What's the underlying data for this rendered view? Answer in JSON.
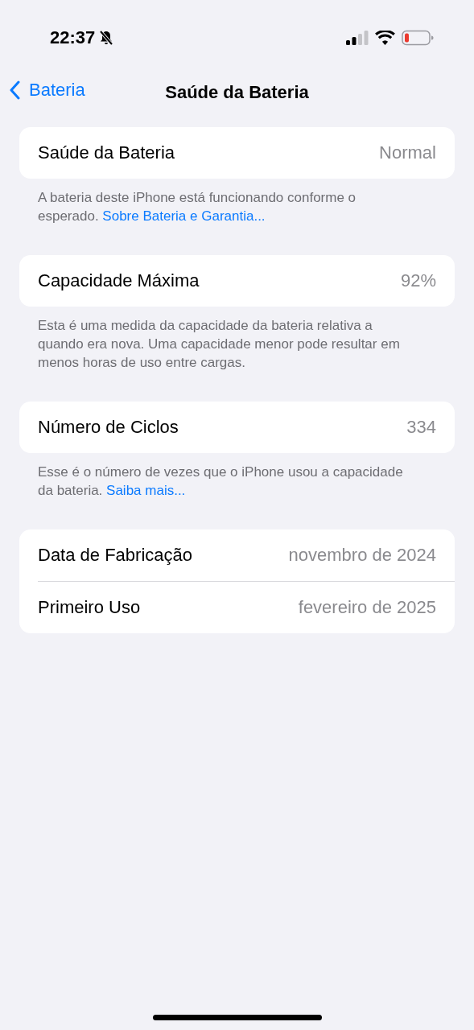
{
  "status_bar": {
    "time": "22:37"
  },
  "nav": {
    "back": "Bateria",
    "title": "Saúde da Bateria"
  },
  "sections": [
    {
      "rows": [
        {
          "label": "Saúde da Bateria",
          "value": "Normal"
        }
      ],
      "footer": {
        "text": "A bateria deste iPhone está funcionando conforme o esperado.",
        "link": "Sobre Bateria e Garantia..."
      }
    },
    {
      "rows": [
        {
          "label": "Capacidade Máxima",
          "value": "92%"
        }
      ],
      "footer": {
        "text": "Esta é uma medida da capacidade da bateria relativa a quando era nova. Uma capacidade menor pode resultar em menos horas de uso entre cargas."
      }
    },
    {
      "rows": [
        {
          "label": "Número de Ciclos",
          "value": "334"
        }
      ],
      "footer": {
        "text": "Esse é o número de vezes que o iPhone usou a capacidade da bateria.",
        "link": "Saiba mais..."
      }
    },
    {
      "rows": [
        {
          "label": "Data de Fabricação",
          "value": "novembro de 2024"
        },
        {
          "label": "Primeiro Uso",
          "value": "fevereiro de 2025"
        }
      ]
    }
  ]
}
